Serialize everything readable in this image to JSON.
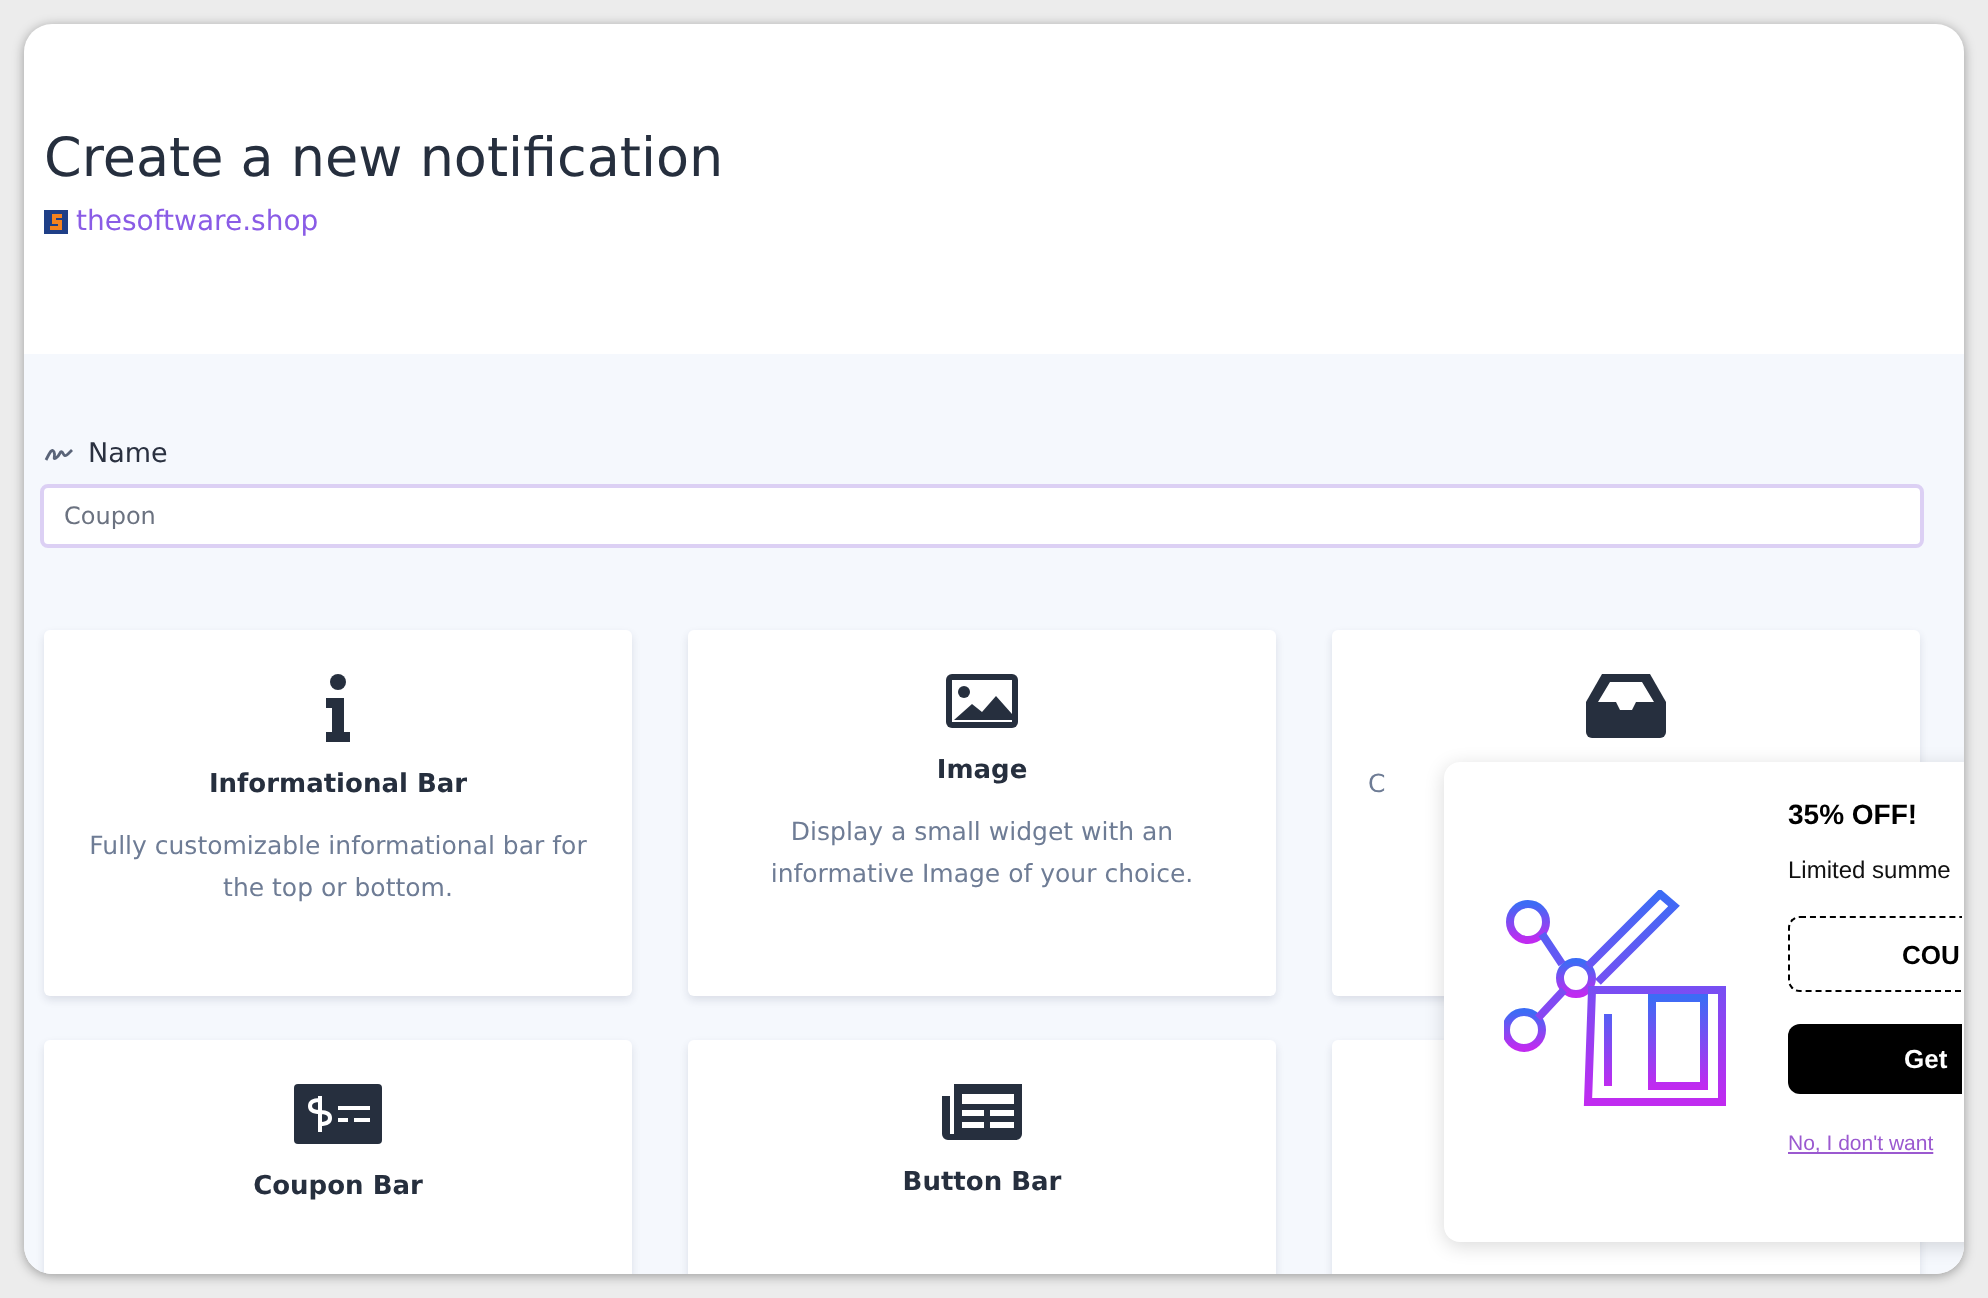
{
  "page": {
    "title": "Create a new notification",
    "site_link": "thesoftware.shop"
  },
  "name_field": {
    "label": "Name",
    "placeholder": "Coupon"
  },
  "cards": [
    {
      "kind": "info",
      "title": "Informational Bar",
      "description": "Fully customizable informational bar for the top or bottom."
    },
    {
      "kind": "image",
      "title": "Image",
      "description": "Display a small widget with an informative Image of your choice."
    },
    {
      "kind": "inbox",
      "description": "C"
    },
    {
      "kind": "coupon",
      "title": "Coupon Bar"
    },
    {
      "kind": "button",
      "title": "Button Bar"
    },
    {
      "kind": "blank"
    }
  ],
  "preview_popup": {
    "headline": "35% OFF!",
    "text": "Limited summe",
    "coupon_code": "COU",
    "button": "Get",
    "decline_link": "No, I don't want"
  }
}
